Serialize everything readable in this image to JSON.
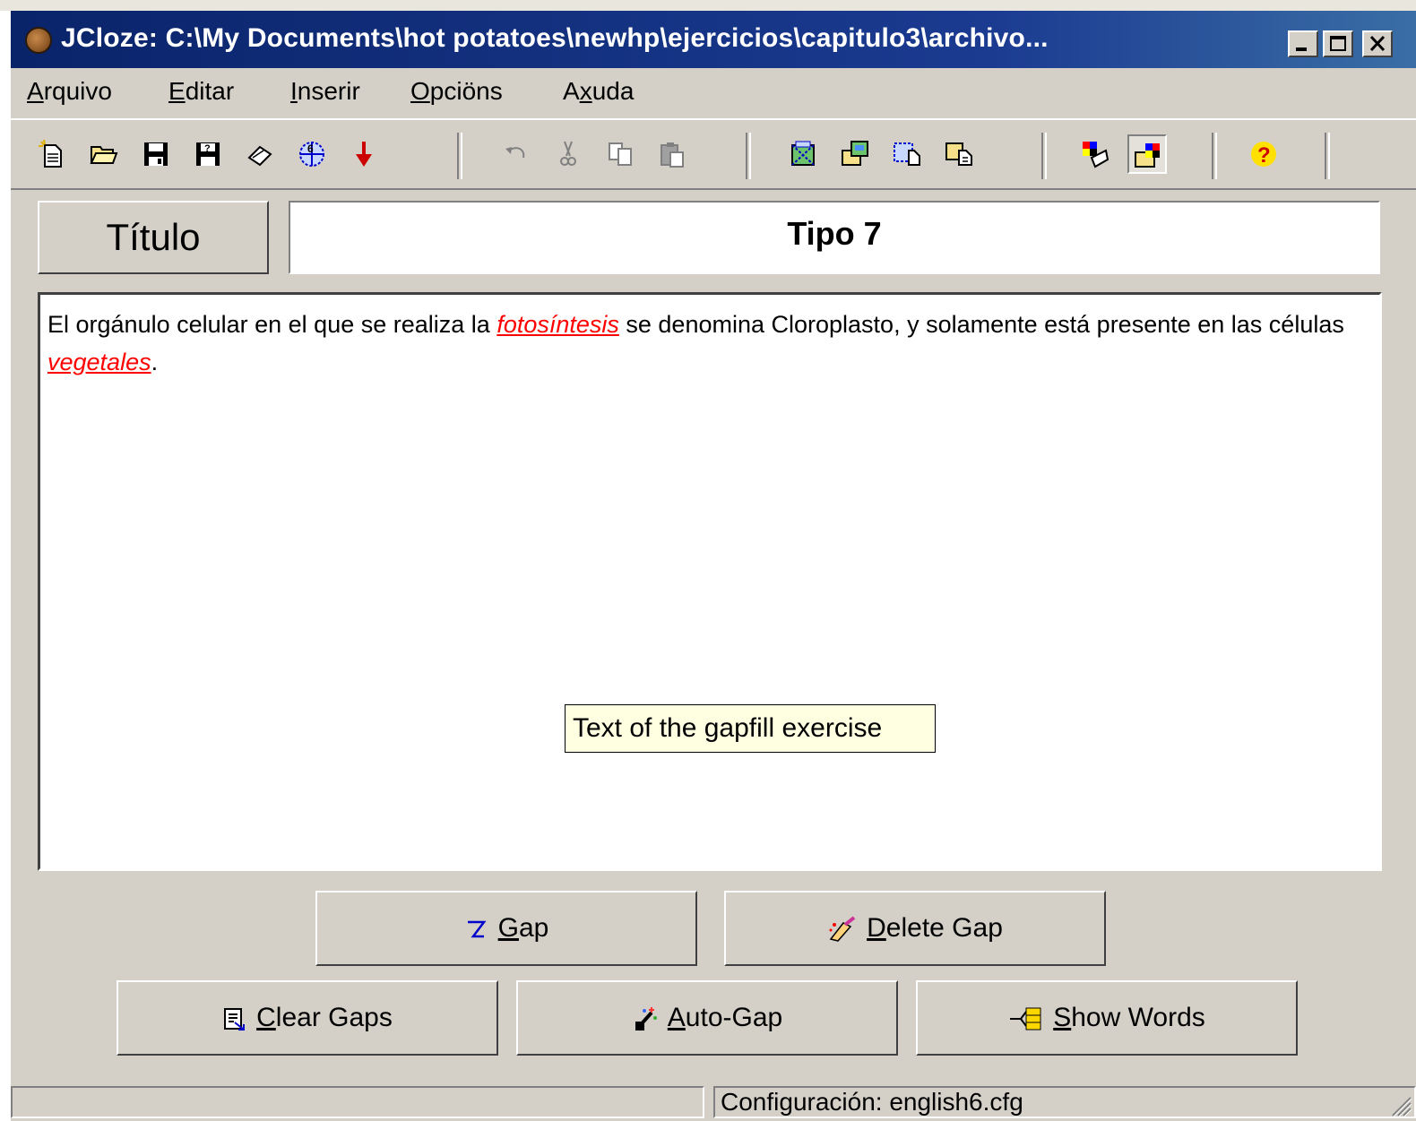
{
  "window": {
    "title": "JCloze: C:\\My Documents\\hot potatoes\\newhp\\ejercicios\\capitulo3\\archivo..."
  },
  "menu": {
    "items": [
      {
        "pre": "",
        "u": "A",
        "post": "rquivo"
      },
      {
        "pre": "",
        "u": "E",
        "post": "ditar"
      },
      {
        "pre": "",
        "u": "I",
        "post": "nserir"
      },
      {
        "pre": "",
        "u": "O",
        "post": "pciöns"
      },
      {
        "pre": "A",
        "u": "x",
        "post": "uda"
      }
    ]
  },
  "toolbar": {
    "icons": [
      "new-file-icon",
      "open-folder-icon",
      "save-icon",
      "save-as-icon",
      "eraser-icon",
      "web-6-icon",
      "red-down-arrow-icon",
      "undo-icon",
      "cut-icon",
      "copy-icon",
      "paste-icon",
      "create-web-page-icon",
      "create-page-icon",
      "create-drag-drop-page-icon",
      "create-hand-page-icon",
      "colors-icon",
      "config-icon",
      "help-icon"
    ]
  },
  "title_label": "Título",
  "title_value": "Tipo 7",
  "exercise": {
    "part1": "El orgánulo celular en el que se realiza la ",
    "gap1": "fotosíntesis",
    "part2": " se denomina Cloroplasto, y solamente está presente en las células ",
    "gap2": "vegetales",
    "part3": "."
  },
  "tooltip": "Text of the gapfill exercise",
  "buttons": {
    "gap": {
      "u": "G",
      "rest": "ap"
    },
    "delete_gap": {
      "u": "D",
      "rest": "elete Gap"
    },
    "clear_gaps": {
      "u": "C",
      "rest": "lear Gaps"
    },
    "auto_gap": {
      "u": "A",
      "rest": "uto-Gap"
    },
    "show_words": {
      "u": "S",
      "rest": "how Words"
    }
  },
  "status": {
    "left": "",
    "config": "Configuración: english6.cfg"
  },
  "colors": {
    "titlebar": "#0a246a",
    "face": "#d4d0c8",
    "gap_text": "#ff0000",
    "tooltip_bg": "#ffffe1"
  }
}
